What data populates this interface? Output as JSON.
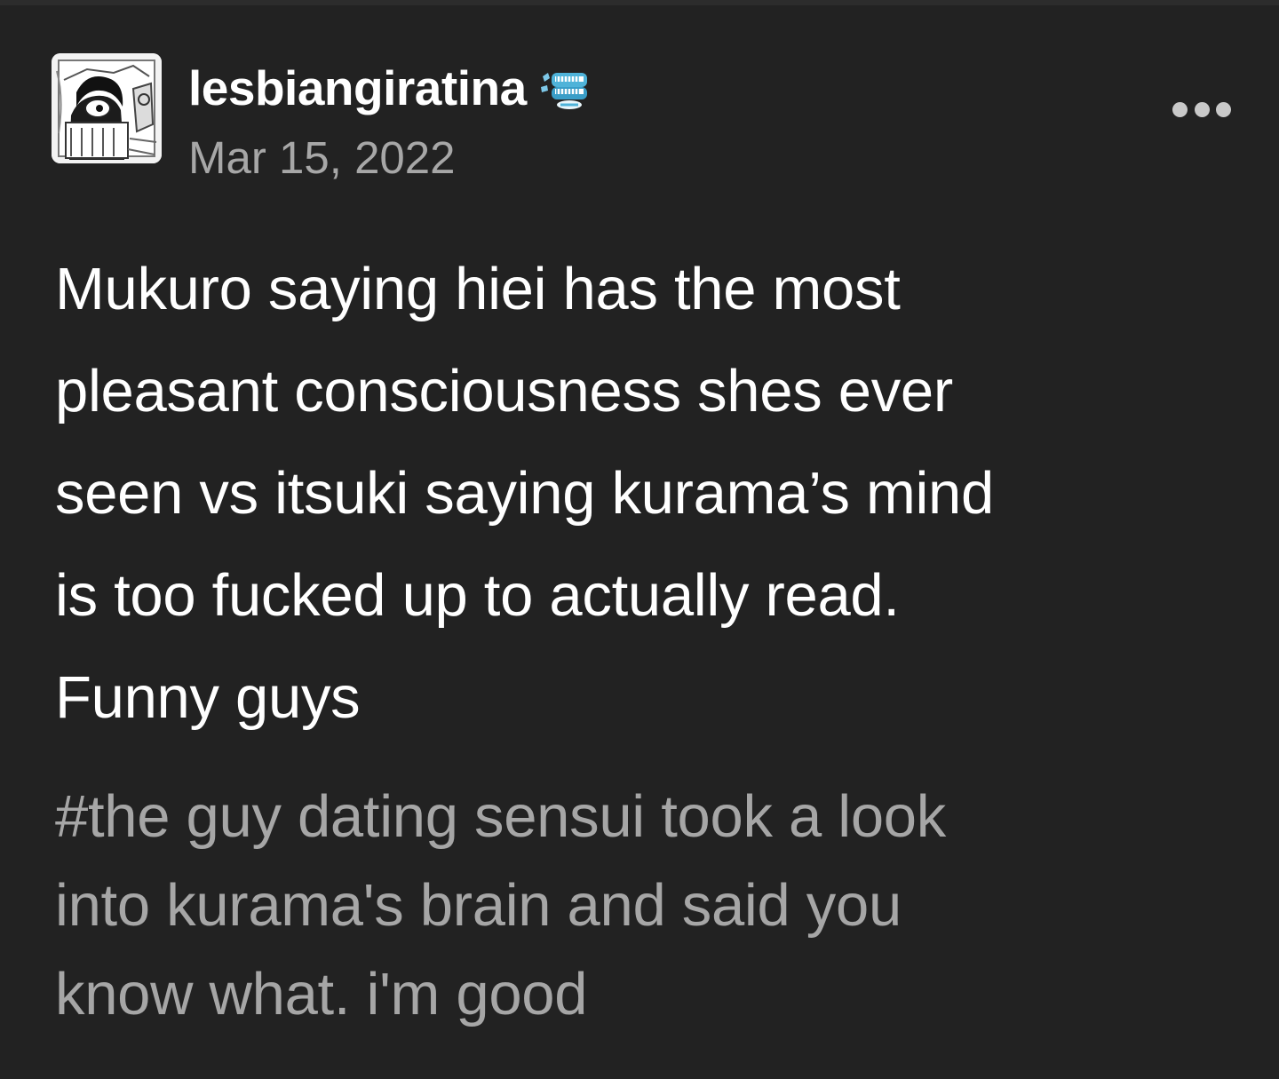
{
  "post": {
    "author": {
      "username": "lesbiangiratina",
      "avatar_icon": "avatar-manga-drawing",
      "badge_icon": "wind-up-teeth-icon"
    },
    "date": "Mar 15, 2022",
    "more_icon": "more-dots-icon",
    "body_lines": [
      "Mukuro saying hiei has the most",
      "pleasant consciousness shes ever",
      "seen vs itsuki saying kurama’s mind",
      "is too fucked up to actually read.",
      "Funny guys"
    ],
    "tag_lines": [
      "#the guy dating sensui took a look",
      "into kurama's brain and said you",
      "know what. i'm good"
    ]
  },
  "colors": {
    "background": "#222222",
    "primary_text": "#ffffff",
    "secondary_text": "#a7a7a7",
    "badge_accent": "#4fb3d9"
  }
}
